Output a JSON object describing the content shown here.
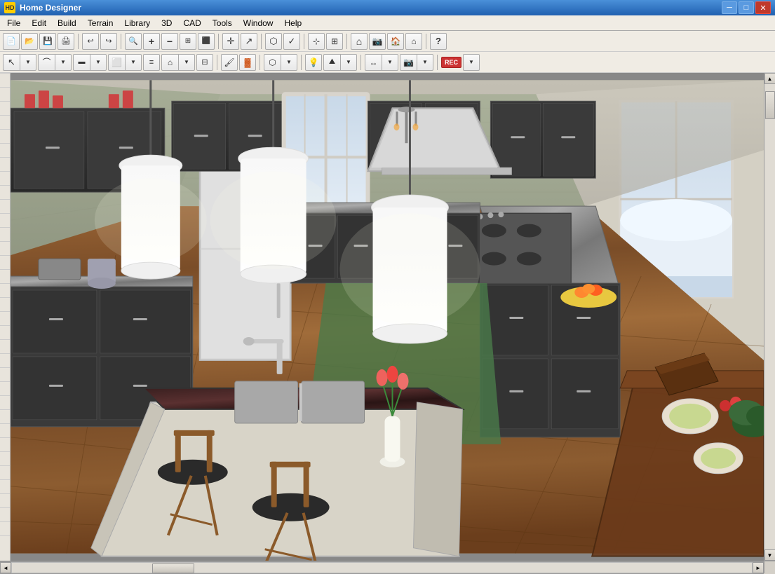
{
  "window": {
    "title": "Home Designer",
    "icon_label": "HD"
  },
  "title_bar_controls": {
    "minimize": "─",
    "maximize": "□",
    "close": "✕"
  },
  "menu": {
    "items": [
      {
        "id": "file",
        "label": "File"
      },
      {
        "id": "edit",
        "label": "Edit"
      },
      {
        "id": "build",
        "label": "Build"
      },
      {
        "id": "terrain",
        "label": "Terrain"
      },
      {
        "id": "library",
        "label": "Library"
      },
      {
        "id": "3d",
        "label": "3D"
      },
      {
        "id": "cad",
        "label": "CAD"
      },
      {
        "id": "tools",
        "label": "Tools"
      },
      {
        "id": "window",
        "label": "Window"
      },
      {
        "id": "help",
        "label": "Help"
      }
    ]
  },
  "toolbar1": {
    "buttons": [
      {
        "id": "new",
        "icon": "📄",
        "title": "New"
      },
      {
        "id": "open",
        "icon": "📂",
        "title": "Open"
      },
      {
        "id": "save",
        "icon": "💾",
        "title": "Save"
      },
      {
        "id": "print",
        "icon": "🖨",
        "title": "Print"
      },
      {
        "id": "undo",
        "icon": "↩",
        "title": "Undo"
      },
      {
        "id": "redo",
        "icon": "↪",
        "title": "Redo"
      },
      {
        "id": "zoom-out-small",
        "icon": "🔍",
        "title": "Zoom"
      },
      {
        "id": "zoom-in",
        "icon": "⊕",
        "title": "Zoom In"
      },
      {
        "id": "zoom-out",
        "icon": "⊖",
        "title": "Zoom Out"
      },
      {
        "id": "fit",
        "icon": "⊡",
        "title": "Fit"
      },
      {
        "id": "pan",
        "icon": "✛",
        "title": "Pan"
      },
      {
        "id": "move",
        "icon": "↔",
        "title": "Move"
      },
      {
        "id": "select",
        "icon": "⊞",
        "title": "Select"
      }
    ]
  },
  "toolbar2": {
    "buttons": [
      {
        "id": "select-tool",
        "icon": "↖",
        "title": "Select"
      },
      {
        "id": "draw-tool",
        "icon": "✏",
        "title": "Draw"
      },
      {
        "id": "wall-tool",
        "icon": "▬",
        "title": "Wall"
      },
      {
        "id": "room-tool",
        "icon": "⬜",
        "title": "Room"
      },
      {
        "id": "roof-tool",
        "icon": "⌂",
        "title": "Roof"
      },
      {
        "id": "stair-tool",
        "icon": "≡",
        "title": "Stairs"
      },
      {
        "id": "door-tool",
        "icon": "🚪",
        "title": "Door"
      },
      {
        "id": "window-tool",
        "icon": "⬛",
        "title": "Window"
      },
      {
        "id": "material-tool",
        "icon": "🎨",
        "title": "Material"
      },
      {
        "id": "light-tool",
        "icon": "💡",
        "title": "Light"
      },
      {
        "id": "terrain-tool",
        "icon": "⛰",
        "title": "Terrain"
      },
      {
        "id": "dimension-tool",
        "icon": "↔",
        "title": "Dimension"
      },
      {
        "id": "camera-tool",
        "icon": "📷",
        "title": "Camera"
      },
      {
        "id": "rec-btn",
        "label": "REC",
        "title": "Record"
      }
    ]
  },
  "scrollbar": {
    "up_arrow": "▲",
    "down_arrow": "▼",
    "left_arrow": "◄",
    "right_arrow": "►"
  },
  "status_bar": {
    "text": ""
  }
}
